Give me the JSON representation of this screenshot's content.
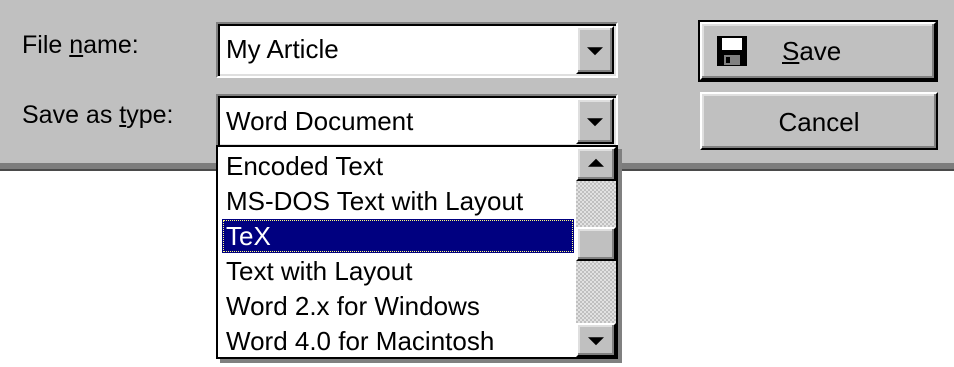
{
  "file_name": {
    "label_prefix": "File ",
    "label_underlined": "n",
    "label_suffix": "ame:",
    "value": "My Article"
  },
  "save_as_type": {
    "label_prefix": "Save as ",
    "label_underlined": "t",
    "label_suffix": "ype:",
    "value": "Word Document",
    "options": [
      "Encoded Text",
      "MS-DOS Text with Layout",
      "TeX",
      "Text with Layout",
      "Word 2.x for Windows",
      "Word 4.0 for Macintosh"
    ],
    "selected_option": "TeX"
  },
  "buttons": {
    "save_underlined": "S",
    "save_rest": "ave",
    "cancel": "Cancel"
  },
  "icons": {
    "save": "floppy-disk-icon",
    "dropdown": "chevron-down-icon",
    "scroll_up": "scroll-up-arrow-icon",
    "scroll_down": "scroll-down-arrow-icon"
  },
  "colors": {
    "dialog_bg": "#c0c0c0",
    "selection_bg": "#000080"
  }
}
